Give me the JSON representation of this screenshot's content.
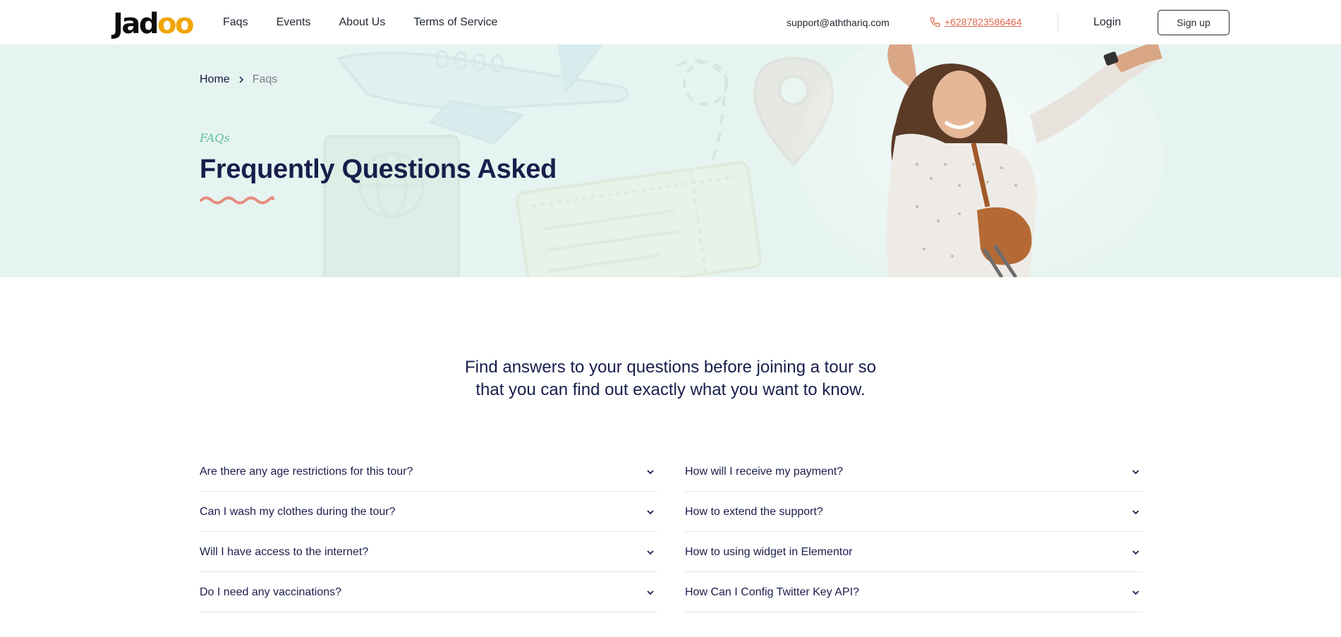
{
  "header": {
    "logo": {
      "text_main": "Jad",
      "text_accent": "oo"
    },
    "nav": [
      {
        "label": "Faqs"
      },
      {
        "label": "Events"
      },
      {
        "label": "About Us"
      },
      {
        "label": "Terms of Service"
      }
    ],
    "email": "support@aththariq.com",
    "phone": "+6287823586464",
    "login_label": "Login",
    "signup_label": "Sign up"
  },
  "hero": {
    "breadcrumb": {
      "home": "Home",
      "current": "Faqs"
    },
    "eyebrow": "FAQs",
    "title": "Frequently Questions Asked"
  },
  "intro": {
    "line1": "Find answers to your questions before joining a tour so",
    "line2": "that you can find out exactly what you want to know."
  },
  "faq": {
    "left": [
      {
        "question": "Are there any age restrictions for this tour?"
      },
      {
        "question": "Can I wash my clothes during the tour?"
      },
      {
        "question": "Will I have access to the internet?"
      },
      {
        "question": "Do I need any vaccinations?"
      }
    ],
    "right": [
      {
        "question": "How will I receive my payment?"
      },
      {
        "question": "How to extend the support?"
      },
      {
        "question": "How to using widget in Elementor"
      },
      {
        "question": "How Can I Config Twitter Key API?"
      }
    ]
  },
  "colors": {
    "accent": "#df6951",
    "brand_dark": "#181e4b",
    "hero_bg": "#e6f4f1",
    "eyebrow": "#5fbf9c",
    "logo_accent": "#f1a501"
  },
  "icons": [
    "phone-icon",
    "chevron-right-icon",
    "chevron-down-icon"
  ]
}
